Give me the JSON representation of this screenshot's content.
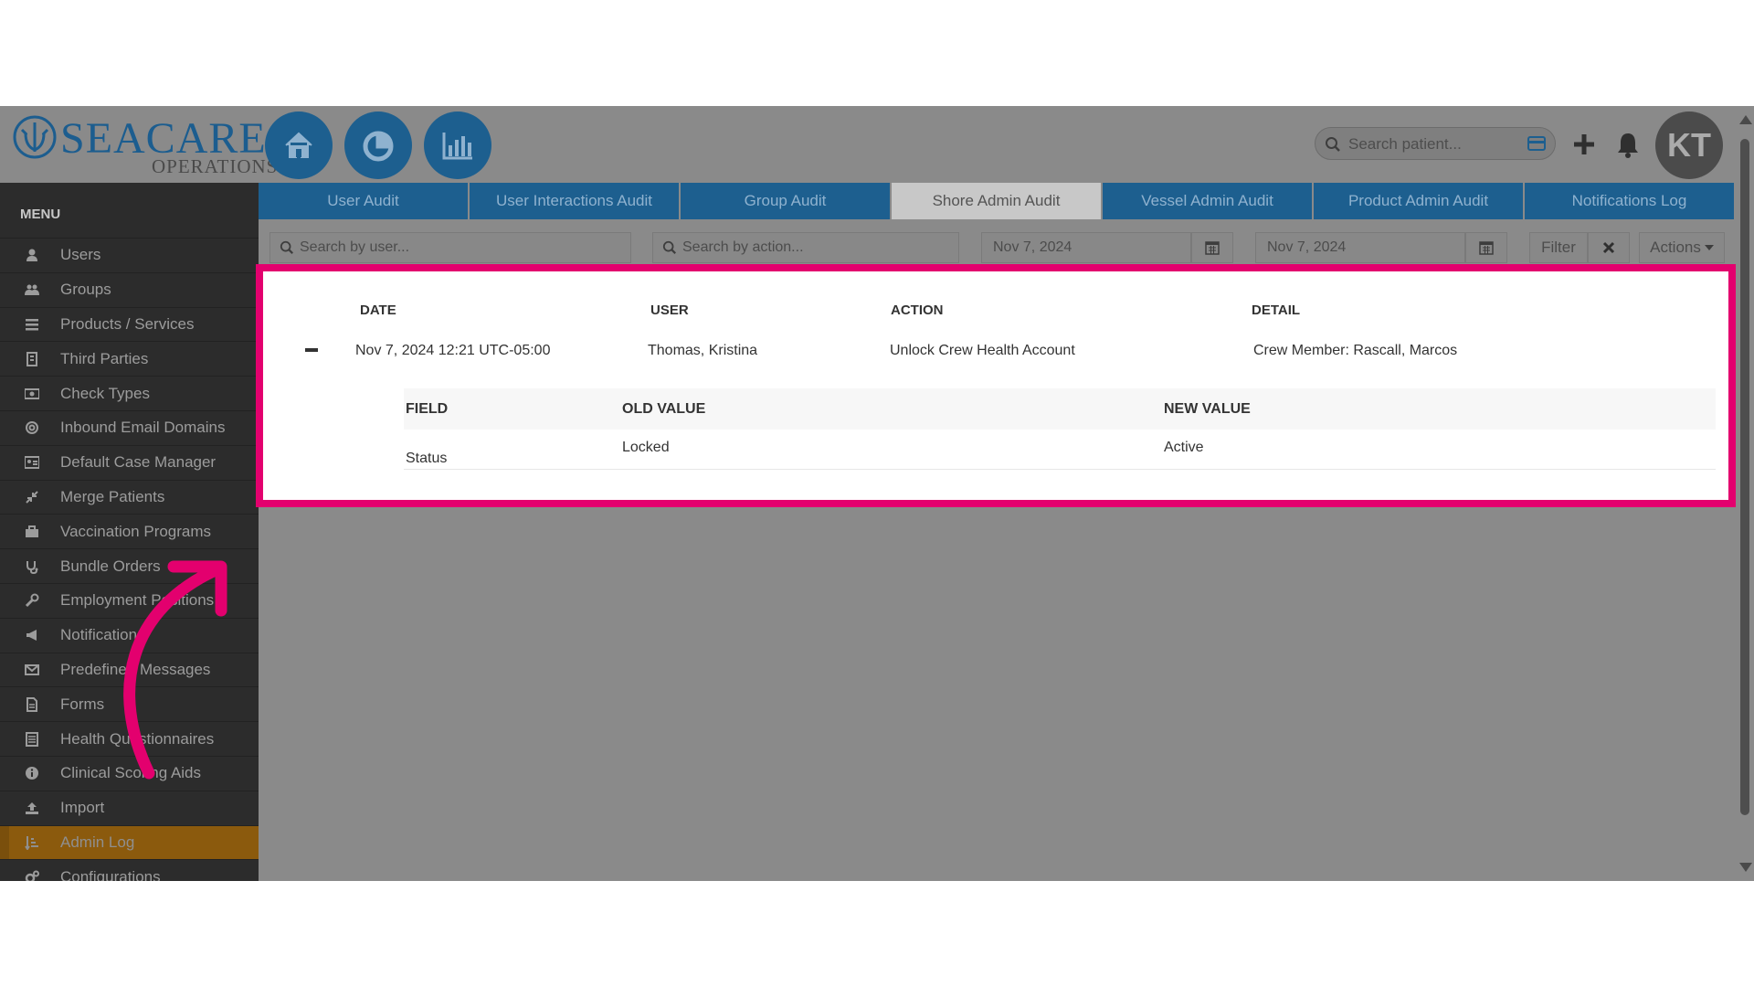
{
  "brand": {
    "name": "SEACARE",
    "sub": "OPERATIONS"
  },
  "header": {
    "search_placeholder": "Search patient...",
    "avatar_initials": "KT",
    "nav_icons": [
      "home-icon",
      "pie-chart-icon",
      "bar-chart-icon"
    ]
  },
  "sidebar": {
    "title": "MENU",
    "items": [
      {
        "label": "Users",
        "icon": "user-icon"
      },
      {
        "label": "Groups",
        "icon": "users-icon"
      },
      {
        "label": "Products / Services",
        "icon": "list-icon"
      },
      {
        "label": "Third Parties",
        "icon": "building-icon"
      },
      {
        "label": "Check Types",
        "icon": "money-icon"
      },
      {
        "label": "Inbound Email Domains",
        "icon": "at-icon"
      },
      {
        "label": "Default Case Manager",
        "icon": "id-card-icon"
      },
      {
        "label": "Merge Patients",
        "icon": "compress-icon"
      },
      {
        "label": "Vaccination Programs",
        "icon": "briefcase-icon"
      },
      {
        "label": "Bundle Orders",
        "icon": "stethoscope-icon"
      },
      {
        "label": "Employment Positions",
        "icon": "wrench-icon"
      },
      {
        "label": "Notifications",
        "icon": "megaphone-icon"
      },
      {
        "label": "Predefined Messages",
        "icon": "envelope-icon"
      },
      {
        "label": "Forms",
        "icon": "file-icon"
      },
      {
        "label": "Health Questionnaires",
        "icon": "form-icon"
      },
      {
        "label": "Clinical Scoring Aids",
        "icon": "info-icon"
      },
      {
        "label": "Import",
        "icon": "upload-icon"
      },
      {
        "label": "Admin Log",
        "icon": "sort-icon",
        "active": true
      },
      {
        "label": "Configurations",
        "icon": "cogs-icon"
      }
    ]
  },
  "tabs": [
    {
      "label": "User Audit"
    },
    {
      "label": "User Interactions Audit"
    },
    {
      "label": "Group Audit"
    },
    {
      "label": "Shore Admin Audit",
      "active": true
    },
    {
      "label": "Vessel Admin Audit"
    },
    {
      "label": "Product Admin Audit"
    },
    {
      "label": "Notifications Log"
    }
  ],
  "filters": {
    "user_placeholder": "Search by user...",
    "action_placeholder": "Search by action...",
    "date_from": "Nov 7, 2024",
    "date_to": "Nov 7, 2024",
    "filter_label": "Filter",
    "actions_label": "Actions"
  },
  "table": {
    "columns": [
      "DATE",
      "USER",
      "ACTION",
      "DETAIL"
    ],
    "rows": [
      {
        "date": "Nov 7, 2024 12:21 UTC-05:00",
        "user": "Thomas, Kristina",
        "action": "Unlock Crew Health Account",
        "detail": "Crew Member: Rascall, Marcos",
        "changes": {
          "columns": [
            "FIELD",
            "OLD VALUE",
            "NEW VALUE"
          ],
          "rows": [
            {
              "field": "Status",
              "old": "Locked",
              "new": "Active"
            }
          ]
        }
      }
    ]
  },
  "colors": {
    "brand_blue": "#1d5f8f",
    "highlight": "#e3006e",
    "active_menu": "#8b5a0d"
  }
}
